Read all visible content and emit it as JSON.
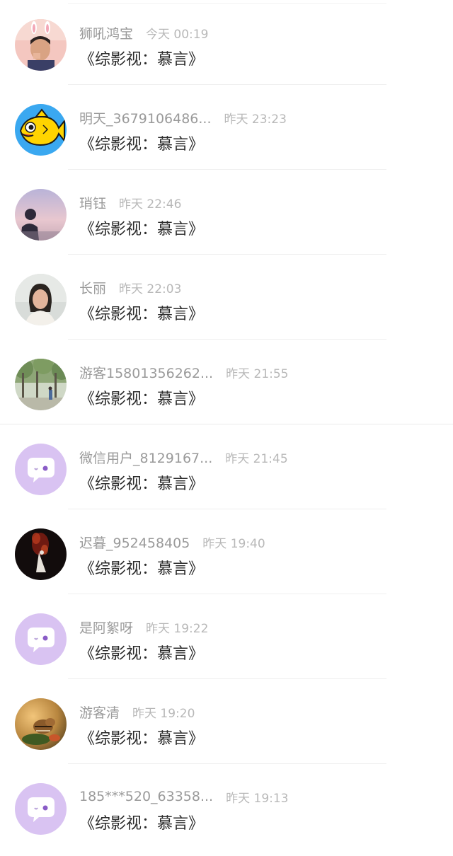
{
  "comments": [
    {
      "name": "狮吼鸿宝",
      "time": "今天 00:19",
      "message": "《综影视：慕言》",
      "avatar": "photo-person-bunny-ears"
    },
    {
      "name": "明天_3679106486...",
      "time": "昨天 23:23",
      "message": "《综影视：慕言》",
      "avatar": "yellow-fish-icon"
    },
    {
      "name": "琑钰",
      "time": "昨天 22:46",
      "message": "《综影视：慕言》",
      "avatar": "photo-silhouette-sky"
    },
    {
      "name": "长丽",
      "time": "昨天 22:03",
      "message": "《综影视：慕言》",
      "avatar": "photo-woman"
    },
    {
      "name": "游客15801356262...",
      "time": "昨天 21:55",
      "message": "《综影视：慕言》",
      "avatar": "photo-trees-path"
    },
    {
      "name": "微信用户_8129167...",
      "time": "昨天 21:45",
      "message": "《综影视：慕言》",
      "avatar": "default-chat-bubble-avatar"
    },
    {
      "name": "迟暮_952458405",
      "time": "昨天 19:40",
      "message": "《综影视：慕言》",
      "avatar": "photo-dark-red-figure"
    },
    {
      "name": "是阿絮呀",
      "time": "昨天 19:22",
      "message": "《综影视：慕言》",
      "avatar": "default-chat-bubble-avatar"
    },
    {
      "name": "游客清",
      "time": "昨天 19:20",
      "message": "《综影视：慕言》",
      "avatar": "photo-chipmunk"
    },
    {
      "name": "185***520_63358...",
      "time": "昨天 19:13",
      "message": "《综影视：慕言》",
      "avatar": "default-chat-bubble-avatar"
    }
  ],
  "colors": {
    "default_avatar_bg": "#d9c3f2",
    "name_text": "#9a9a9a",
    "time_text": "#b8b8b8",
    "message_text": "#2b2b2b"
  }
}
